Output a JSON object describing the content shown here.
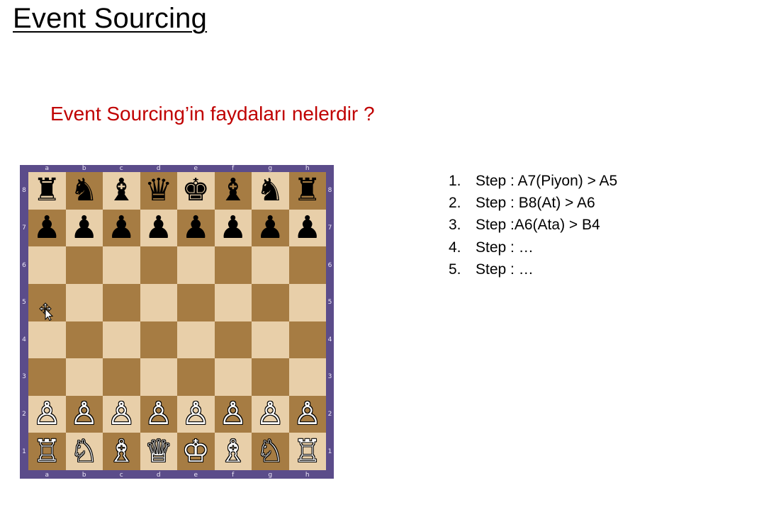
{
  "slide": {
    "title": "Event Sourcing",
    "subtitle": "Event Sourcing’in faydaları nelerdir ?"
  },
  "board": {
    "files": [
      "a",
      "b",
      "c",
      "d",
      "e",
      "f",
      "g",
      "h"
    ],
    "ranks": [
      "8",
      "7",
      "6",
      "5",
      "4",
      "3",
      "2",
      "1"
    ],
    "colors": {
      "light": "#e8cfa9",
      "dark": "#a67c43",
      "frame": "#5b4c8a"
    },
    "rows": [
      [
        "♜",
        "♞",
        "♝",
        "♛",
        "♚",
        "♝",
        "♞",
        "♜"
      ],
      [
        "♟",
        "♟",
        "♟",
        "♟",
        "♟",
        "♟",
        "♟",
        "♟"
      ],
      [
        "",
        "",
        "",
        "",
        "",
        "",
        "",
        ""
      ],
      [
        "",
        "",
        "",
        "",
        "",
        "",
        "",
        ""
      ],
      [
        "",
        "",
        "",
        "",
        "",
        "",
        "",
        ""
      ],
      [
        "",
        "",
        "",
        "",
        "",
        "",
        "",
        ""
      ],
      [
        "♙",
        "♙",
        "♙",
        "♙",
        "♙",
        "♙",
        "♙",
        "♙"
      ],
      [
        "♖",
        "♘",
        "♗",
        "♕",
        "♔",
        "♗",
        "♘",
        "♖"
      ]
    ],
    "cursor_icon": "move-cursor-icon"
  },
  "steps": [
    {
      "num": "1.",
      "text": "Step :  A7(Piyon) > A5"
    },
    {
      "num": "2.",
      "text": "Step : B8(At) > A6"
    },
    {
      "num": "3.",
      "text": "Step :A6(Ata) > B4"
    },
    {
      "num": "4.",
      "text": "Step : …"
    },
    {
      "num": "5.",
      "text": "Step : …"
    }
  ]
}
